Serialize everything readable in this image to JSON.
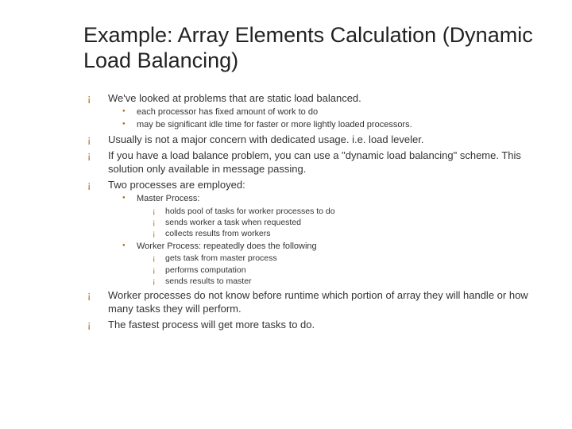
{
  "title": "Example: Array Elements Calculation (Dynamic Load Balancing)",
  "b1": {
    "text": "We've looked at problems that are static load balanced.",
    "sub": [
      "each processor has fixed amount of work to do",
      "may be significant idle time for faster or more lightly loaded processors."
    ]
  },
  "b2": "Usually is not a major concern with dedicated usage. i.e. load leveler.",
  "b3": "If you have a load balance problem, you can use a \"dynamic load balancing\" scheme. This solution only available in message passing.",
  "b4": {
    "text": "Two processes are employed:",
    "sub": [
      {
        "text": "Master Process:",
        "sub": [
          "holds pool of tasks for worker processes to do",
          "sends worker a task when requested",
          "collects results from workers"
        ]
      },
      {
        "text": "Worker Process: repeatedly does the following",
        "sub": [
          "gets task from master process",
          "performs computation",
          "sends results to master"
        ]
      }
    ]
  },
  "b5": "Worker processes do not know before runtime which portion of array they will handle or how many tasks they will perform.",
  "b6": "The fastest process will get more tasks to do."
}
